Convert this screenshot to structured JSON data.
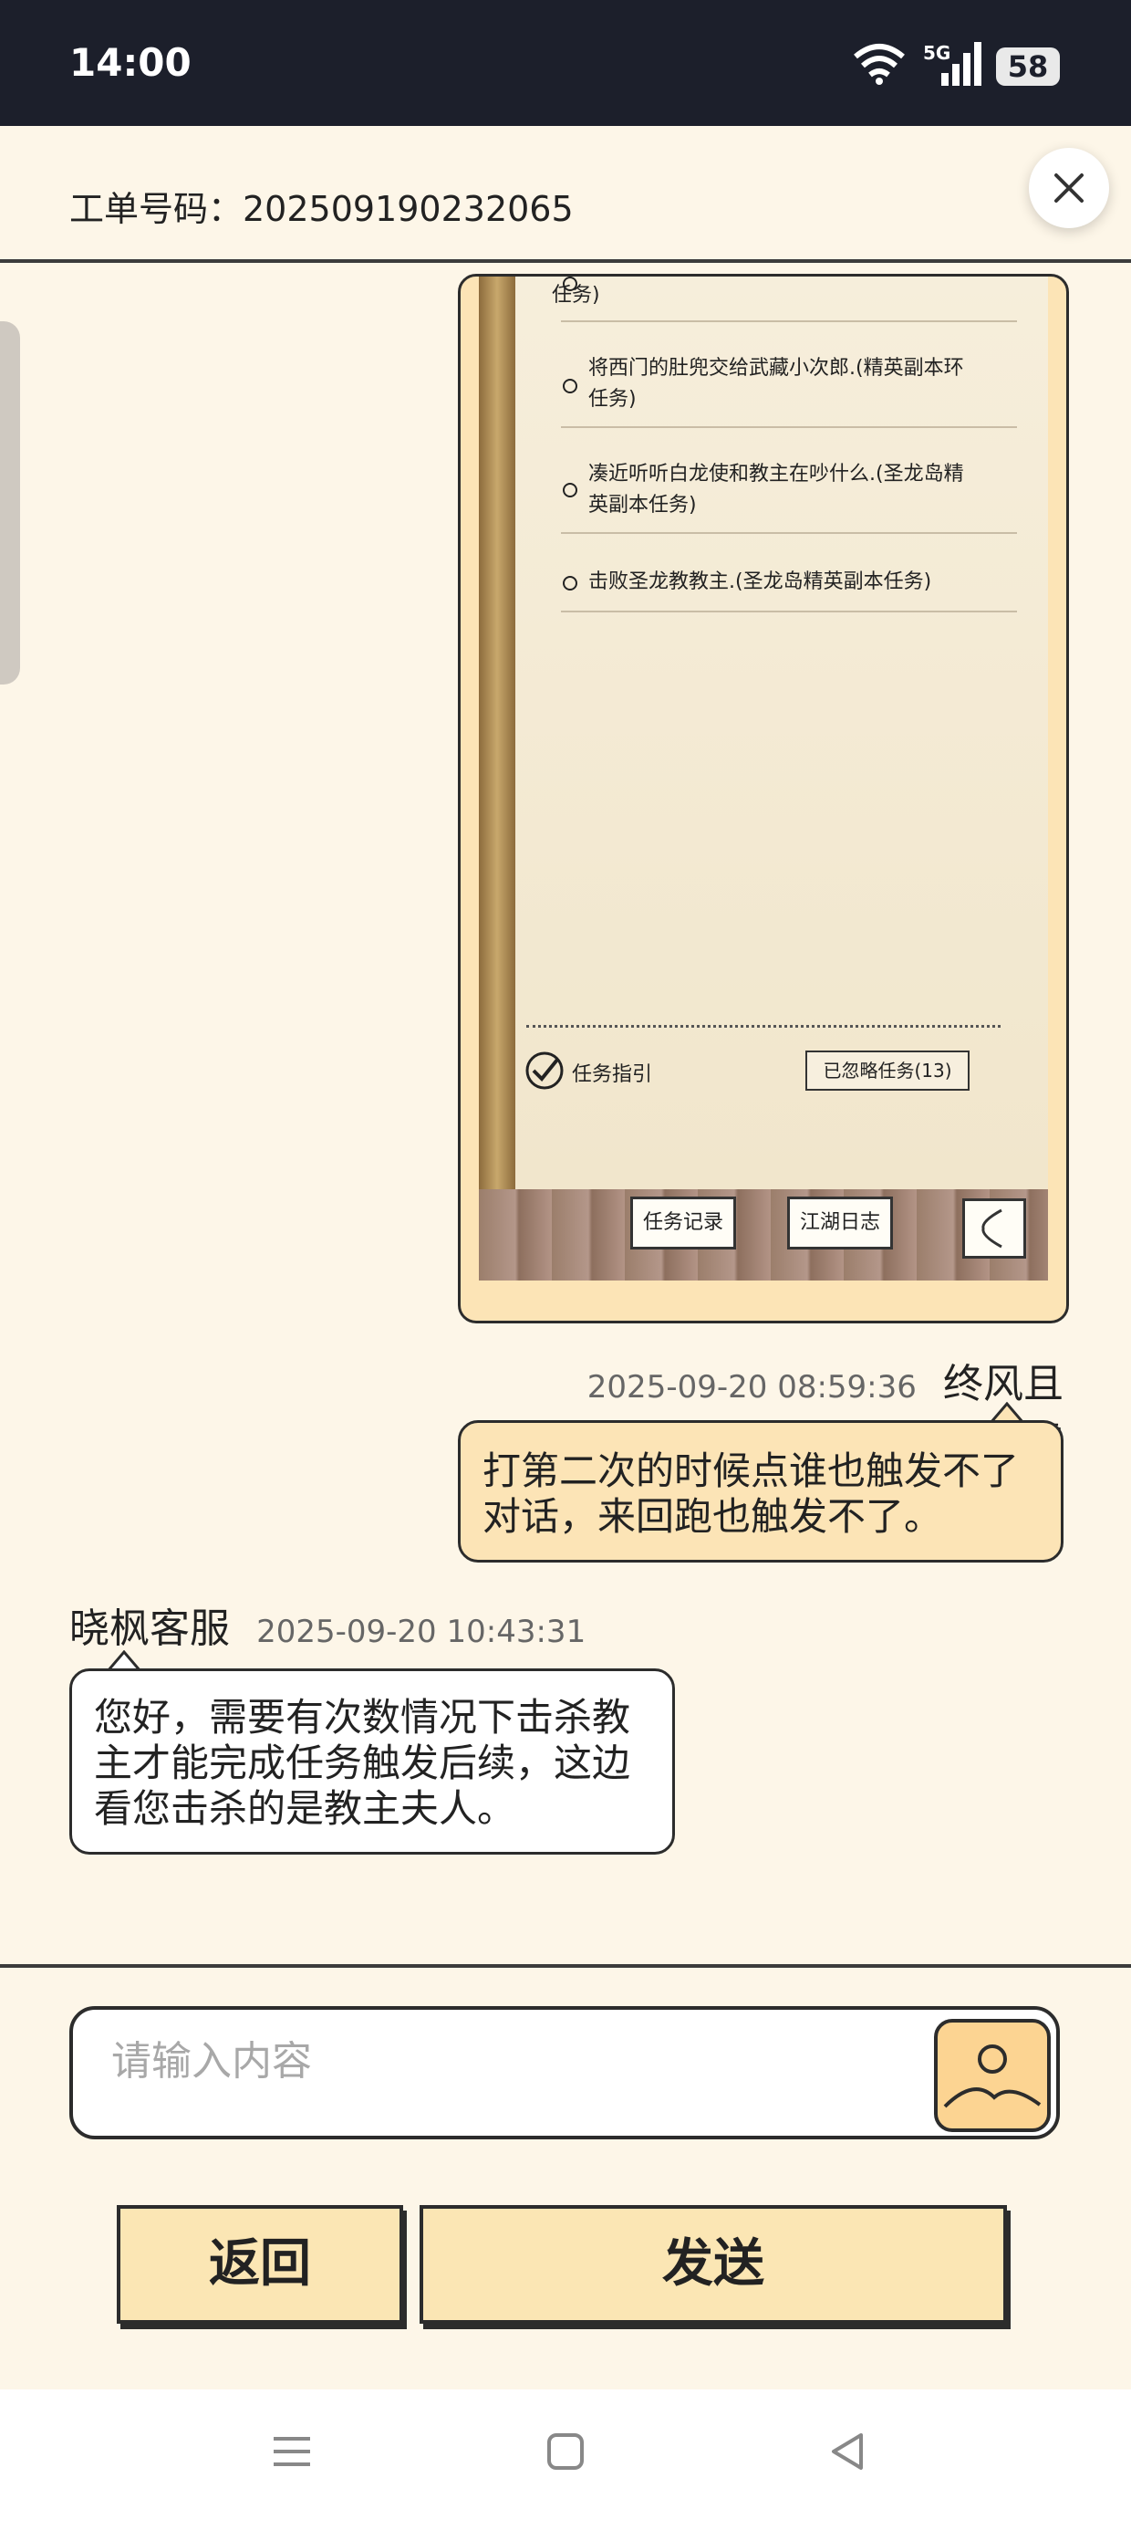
{
  "status_bar": {
    "time": "14:00",
    "network": "5G",
    "battery": "58"
  },
  "header": {
    "ticket_label": "工单号码：202509190232065"
  },
  "screenshot": {
    "tasks": [
      "任务)",
      "将西门的肚兜交给武藏小次郎.(精英副本环任务)",
      "凑近听听白龙使和教主在吵什么.(圣龙岛精英副本任务)",
      "击败圣龙教教主.(圣龙岛精英副本任务)"
    ],
    "guide_label": "任务指引",
    "ignored_label": "已忽略任务(13)",
    "tab_records": "任务记录",
    "tab_journal": "江湖日志"
  },
  "messages": {
    "user_time": "2025-09-20 08:59:36",
    "user_name": "终风且霾",
    "user_text": "打第二次的时候点谁也触发不了对话，来回跑也触发不了。",
    "agent_name": "晓枫客服",
    "agent_time": "2025-09-20 10:43:31",
    "agent_text": "您好，需要有次数情况下击杀教主才能完成任务触发后续，这边看您击杀的是教主夫人。"
  },
  "input": {
    "placeholder": "请输入内容"
  },
  "buttons": {
    "back": "返回",
    "send": "发送"
  },
  "colors": {
    "accent": "#fce4b6",
    "button": "#fbe6b4",
    "status_bar": "#1c1f2b"
  }
}
